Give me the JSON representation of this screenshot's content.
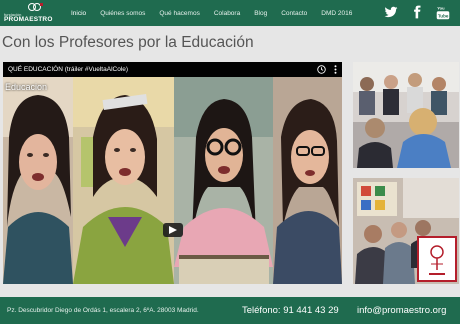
{
  "brand": {
    "small_label": "fundación",
    "name": "PROMAESTRO",
    "primary_color": "#1f6b4f",
    "accent_color": "#b41e2b"
  },
  "nav": {
    "items": [
      {
        "label": "Inicio",
        "active": true
      },
      {
        "label": "Quiénes somos",
        "active": false
      },
      {
        "label": "Qué hacemos",
        "active": false
      },
      {
        "label": "Colabora",
        "active": false
      },
      {
        "label": "Blog",
        "active": false
      },
      {
        "label": "Contacto",
        "active": false
      },
      {
        "label": "DMD 2016",
        "active": false
      }
    ]
  },
  "social": {
    "icons": [
      "twitter-icon",
      "facebook-icon",
      "youtube-icon"
    ]
  },
  "page": {
    "title": "Con los Profesores por la Educación"
  },
  "video": {
    "title": "QUÉ EDUCACIÓN (tráiler #VueltaAlCole)",
    "overlay_text": "Educacion",
    "icons": [
      "clock-icon",
      "more-vertical-icon",
      "play-icon"
    ]
  },
  "footer": {
    "address": "Pz. Descubridor Diego de Ordás 1, escalera 2, 6ºA. 28003 Madrid.",
    "phone": "Teléfono: 91 441 43 29",
    "email": "info@promaestro.org"
  }
}
